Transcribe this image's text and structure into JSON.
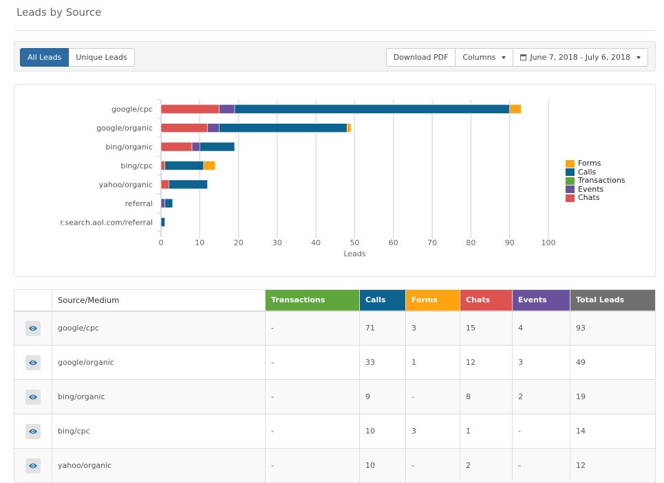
{
  "header": {
    "title": "Leads by Source"
  },
  "toolbar": {
    "toggle": [
      {
        "label": "All Leads",
        "active": true
      },
      {
        "label": "Unique Leads",
        "active": false
      }
    ],
    "download_label": "Download PDF",
    "columns_label": "Columns",
    "date_range": "June 7, 2018 - July 6, 2018"
  },
  "colors": {
    "Forms": "#ffa30f",
    "Calls": "#0d6490",
    "Transactions": "#5fa63c",
    "Events": "#6a519c",
    "Chats": "#dc5350",
    "Total": "#707070"
  },
  "chart_data": {
    "type": "bar",
    "orientation": "horizontal",
    "stacked": true,
    "categories": [
      "google/cpc",
      "google/organic",
      "bing/organic",
      "bing/cpc",
      "yahoo/organic",
      "referral",
      "r.search.aol.com/referral"
    ],
    "series": [
      {
        "name": "Chats",
        "values": [
          15,
          12,
          8,
          1,
          2,
          0,
          0
        ]
      },
      {
        "name": "Events",
        "values": [
          4,
          3,
          2,
          0,
          0,
          1,
          0
        ]
      },
      {
        "name": "Transactions",
        "values": [
          0,
          0,
          0,
          0,
          0,
          0,
          0
        ]
      },
      {
        "name": "Calls",
        "values": [
          71,
          33,
          9,
          10,
          10,
          2,
          1
        ]
      },
      {
        "name": "Forms",
        "values": [
          3,
          1,
          0,
          3,
          0,
          0,
          0
        ]
      }
    ],
    "legend": [
      "Forms",
      "Calls",
      "Transactions",
      "Events",
      "Chats"
    ],
    "legend_position": "right",
    "xlabel": "Leads",
    "ylabel": "",
    "xlim": [
      0,
      100
    ],
    "xticks": [
      "0",
      "10",
      "20",
      "30",
      "40",
      "50",
      "60",
      "70",
      "80",
      "90",
      "100"
    ],
    "grid": true
  },
  "table": {
    "headers": [
      "",
      "Source/Medium",
      "Transactions",
      "Calls",
      "Forms",
      "Chats",
      "Events",
      "Total Leads"
    ],
    "rows": [
      [
        "google/cpc",
        "-",
        "71",
        "3",
        "15",
        "4",
        "93"
      ],
      [
        "google/organic",
        "-",
        "33",
        "1",
        "12",
        "3",
        "49"
      ],
      [
        "bing/organic",
        "-",
        "9",
        "-",
        "8",
        "2",
        "19"
      ],
      [
        "bing/cpc",
        "-",
        "10",
        "3",
        "1",
        "-",
        "14"
      ],
      [
        "yahoo/organic",
        "-",
        "10",
        "-",
        "2",
        "-",
        "12"
      ]
    ]
  }
}
